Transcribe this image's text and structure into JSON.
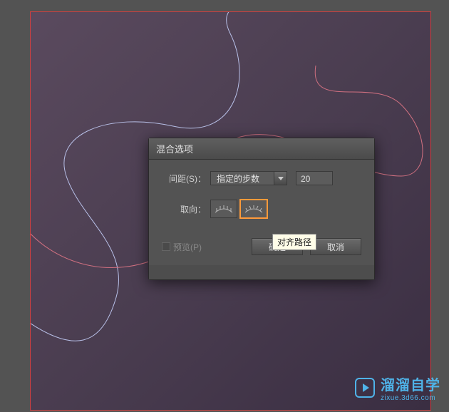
{
  "dialog": {
    "title": "混合选项",
    "spacing": {
      "label": "间距(S)：",
      "mode": "指定的步数",
      "value": "20"
    },
    "orientation": {
      "label": "取向："
    },
    "preview_label": "预览(P)",
    "ok_label": "确定",
    "cancel_label": "取消"
  },
  "tooltip": "对齐路径",
  "watermark": {
    "main": "溜溜自学",
    "sub": "zixue.3d66.com"
  }
}
